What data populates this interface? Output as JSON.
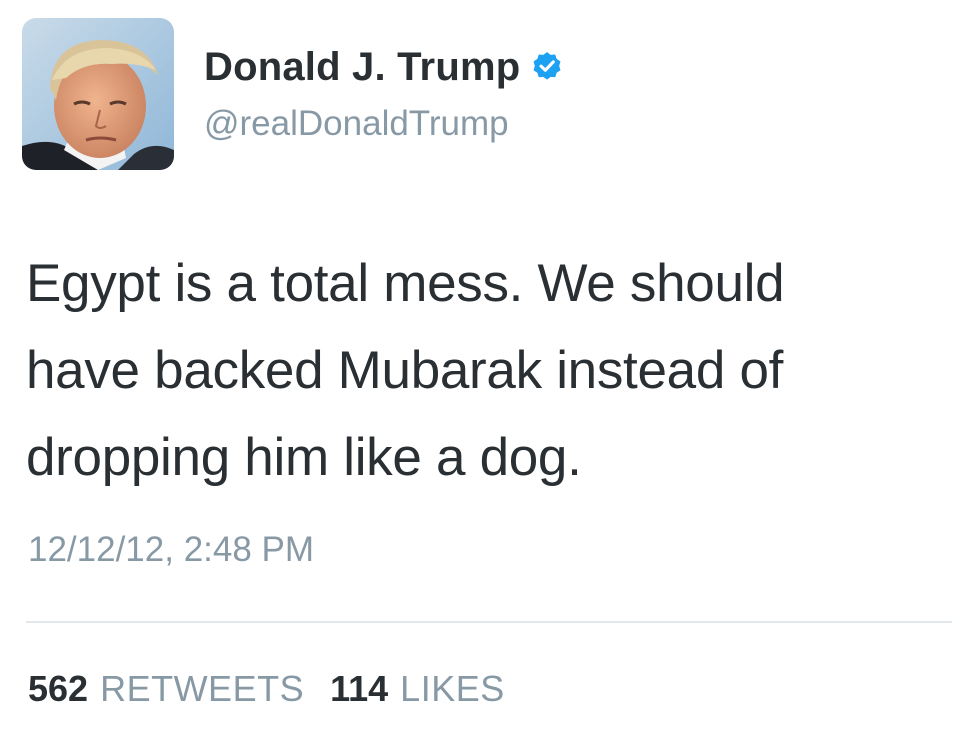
{
  "user": {
    "display_name": "Donald J. Trump",
    "handle": "@realDonaldTrump",
    "verified": true,
    "avatar_icon": "profile-photo"
  },
  "tweet": {
    "text_lines": [
      "Egypt is a total mess. We should",
      "have backed Mubarak instead of",
      "dropping him like a dog."
    ],
    "timestamp": "12/12/12, 2:48 PM"
  },
  "stats": {
    "retweets_count": "562",
    "retweets_label": "RETWEETS",
    "likes_count": "114",
    "likes_label": "LIKES"
  },
  "colors": {
    "primary_text": "#292f33",
    "secondary_text": "#8899a6",
    "verified_blue": "#1da1f2",
    "divider": "#e1e8ed"
  }
}
